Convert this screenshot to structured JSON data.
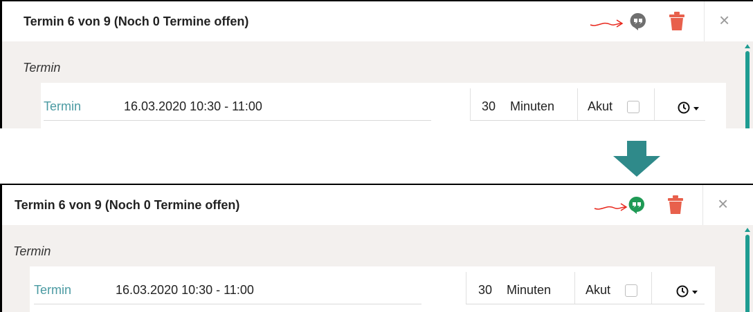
{
  "panels": [
    {
      "title": "Termin 6 von 9 (Noch 0 Termine offen)",
      "section_title": "Termin",
      "field_label": "Termin",
      "field_value": "16.03.2020 10:30 - 11:00",
      "duration_value": "30",
      "duration_unit": "Minuten",
      "akut_label": "Akut",
      "chat_icon_color": "#6f6f6f"
    },
    {
      "title": "Termin 6 von 9 (Noch 0 Termine offen)",
      "section_title": "Termin",
      "field_label": "Termin",
      "field_value": "16.03.2020 10:30 - 11:00",
      "duration_value": "30",
      "duration_unit": "Minuten",
      "akut_label": "Akut",
      "chat_icon_color": "#1f9a55"
    }
  ],
  "colors": {
    "accent_teal": "#4a9aa2",
    "trash_red": "#e8604c",
    "annotation_red": "#e8261b",
    "arrow_teal": "#2f8a8a",
    "scrollbar_teal": "#1e9c91"
  },
  "icons": {
    "close": "×",
    "chat": "hangouts-chat-icon",
    "trash": "trash-icon",
    "clock": "clock-icon",
    "caret": "caret-down-icon"
  }
}
